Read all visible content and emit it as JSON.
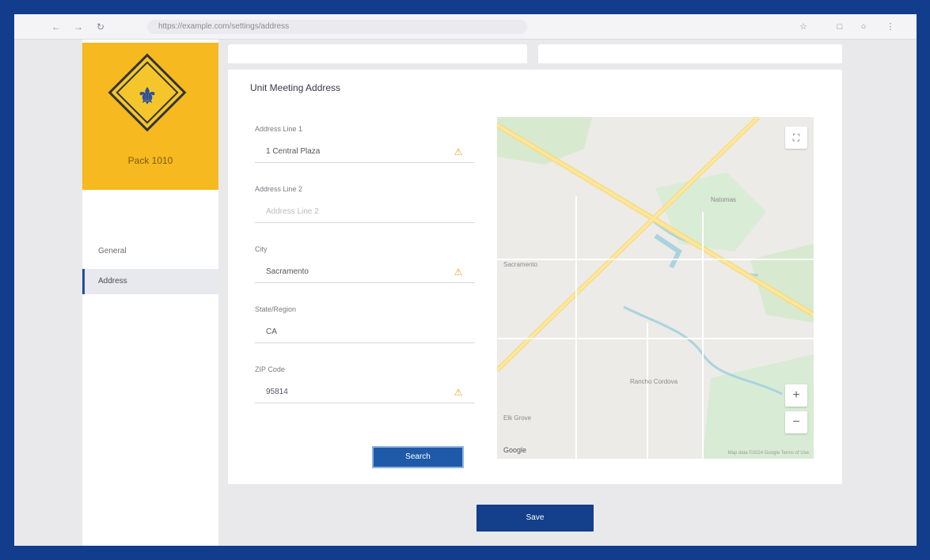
{
  "browser": {
    "url": "https://example.com/settings/address",
    "nav_icons": [
      "back-icon",
      "forward-icon",
      "reload-icon"
    ],
    "tool_icons": [
      "star-icon",
      "extension-icon",
      "profile-icon",
      "menu-icon"
    ]
  },
  "sidebar": {
    "logo_text": "Pack 1010",
    "section_label": "",
    "items": [
      {
        "label": "General"
      },
      {
        "label": "Address"
      }
    ]
  },
  "form": {
    "title": "Unit Meeting Address",
    "fields": [
      {
        "label": "Address Line 1",
        "value": "1 Central Plaza",
        "warning": true
      },
      {
        "label": "Address Line 2",
        "placeholder": "Address Line 2",
        "warning": false
      },
      {
        "label": "City",
        "value": "Sacramento",
        "warning": true
      },
      {
        "label": "State/Region",
        "value": "CA",
        "warning": false
      },
      {
        "label": "ZIP Code",
        "value": "95814",
        "warning": true
      }
    ],
    "search_label": "Search"
  },
  "map": {
    "labels": [
      "Sacramento",
      "Natomas",
      "Rancho Cordova",
      "Elk Grove"
    ],
    "zoom_in": "+",
    "zoom_out": "−",
    "attribution": "Map data ©2024 Google  Terms of Use",
    "google_logo": "Google"
  },
  "footer": {
    "save_label": "Save"
  },
  "colors": {
    "frame": "#123c8c",
    "accent": "#1f5aa8",
    "logo_bg": "#f6b91f",
    "warning": "#f0a020"
  }
}
